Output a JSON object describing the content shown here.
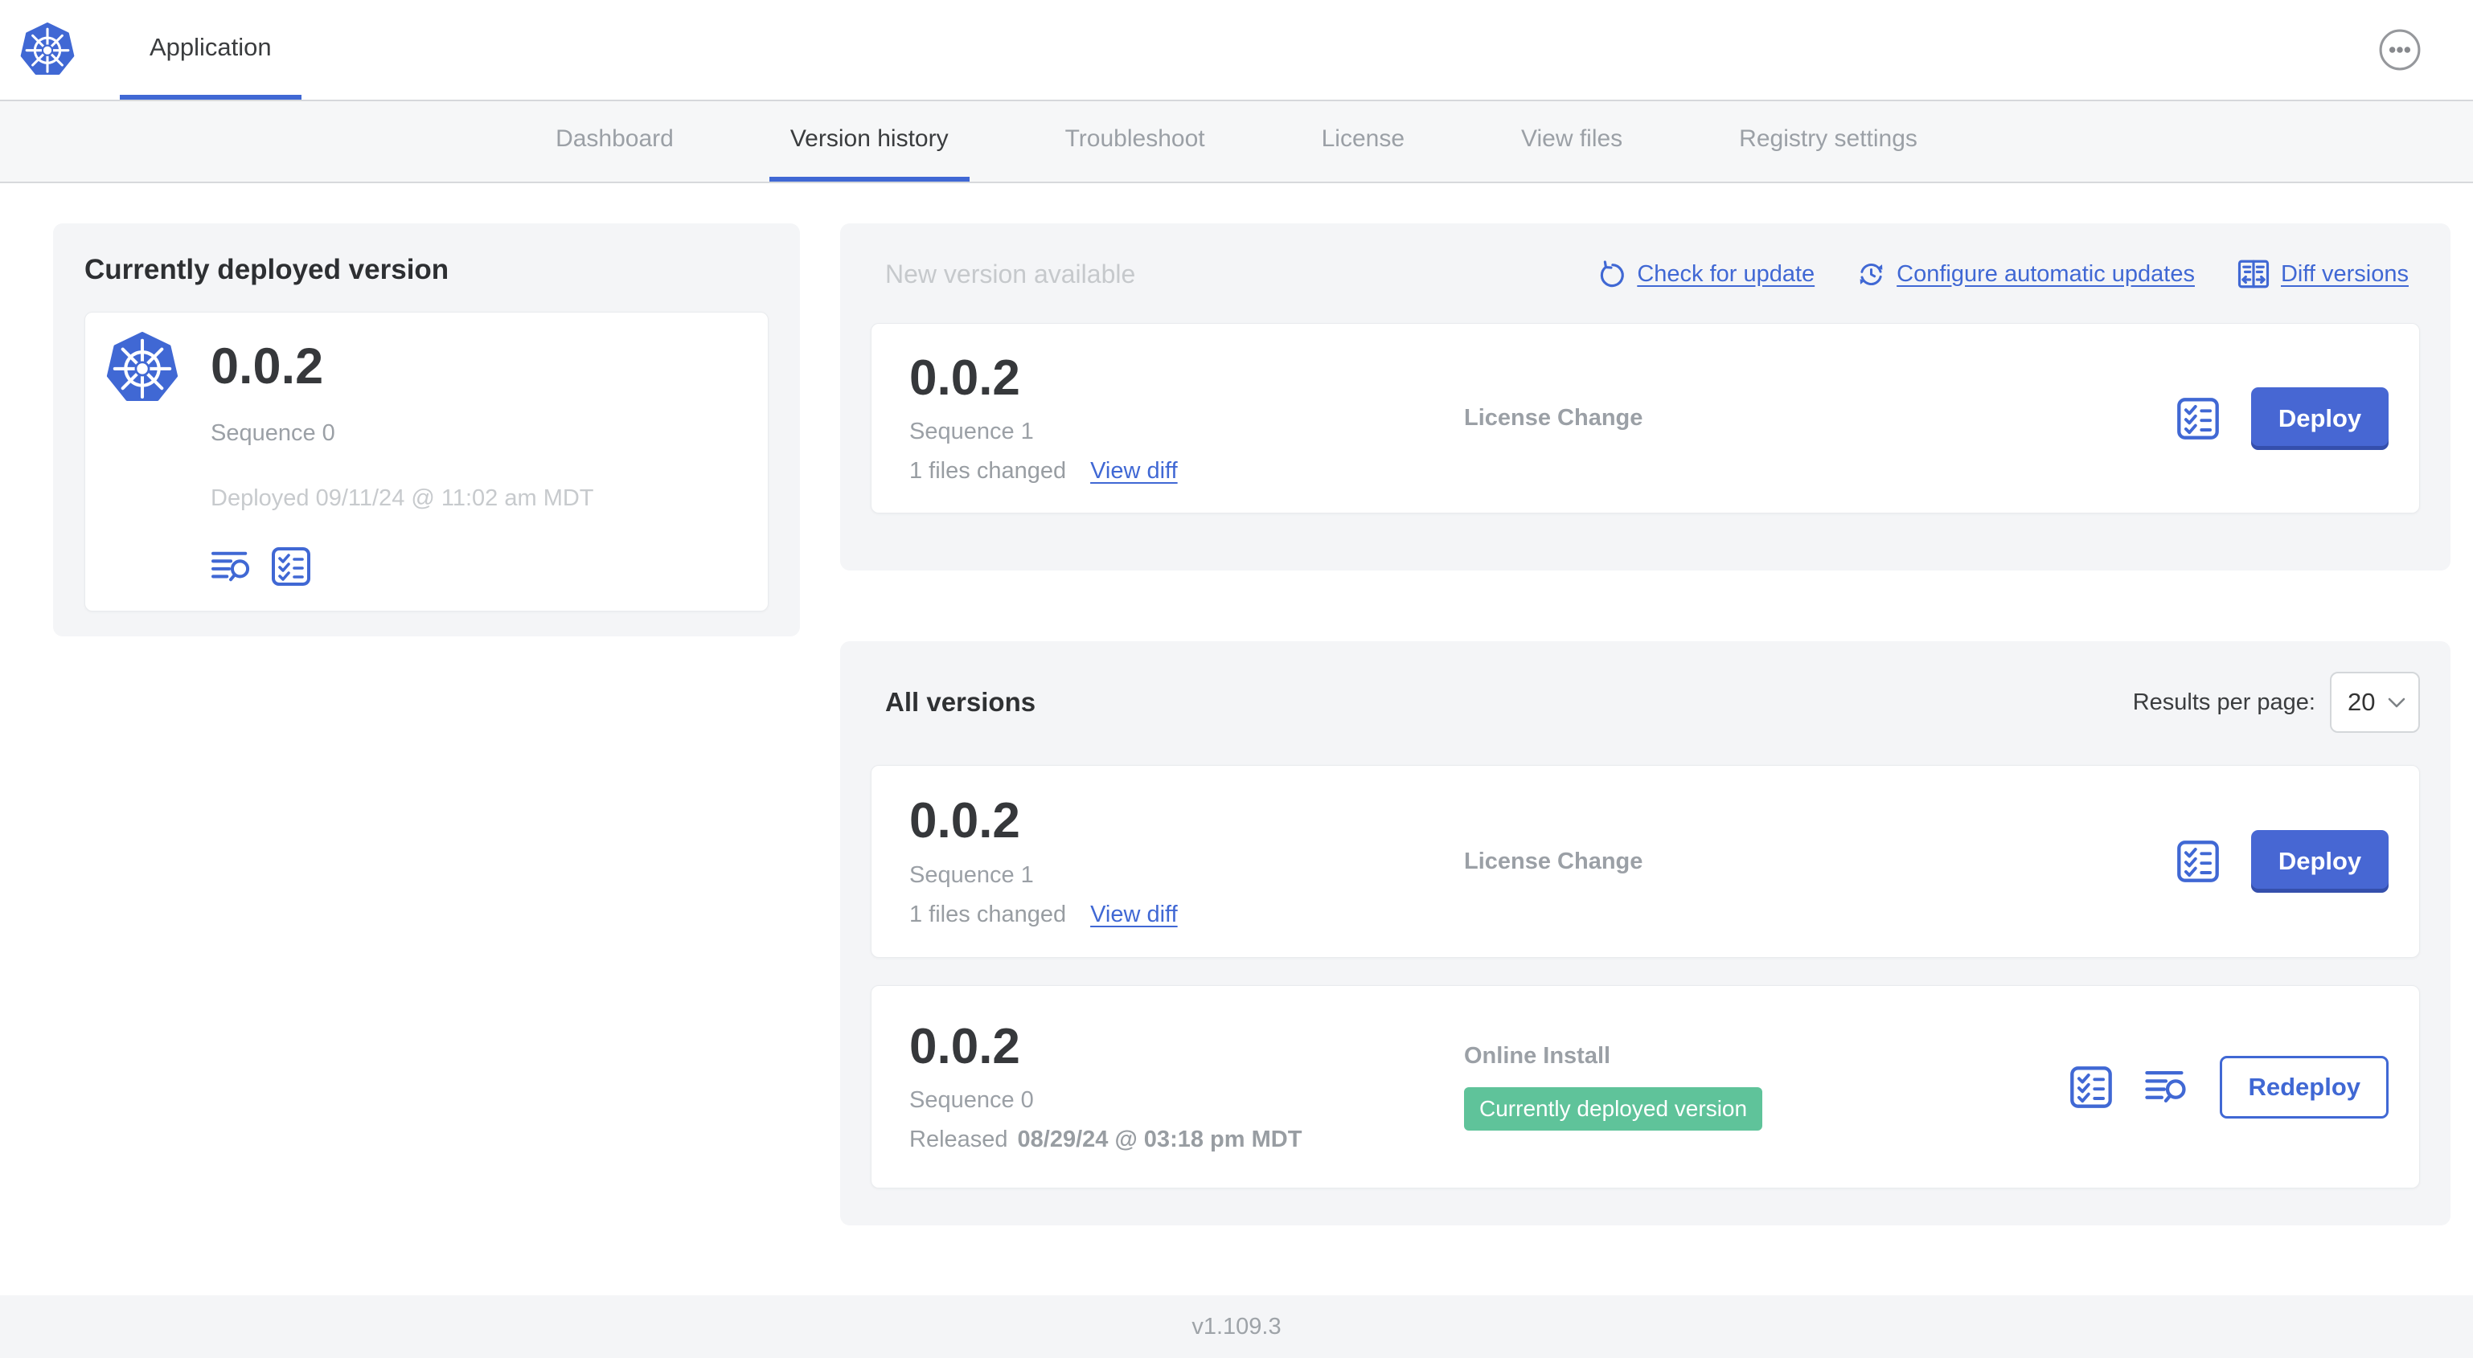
{
  "header": {
    "app_tab": "Application",
    "logo_icon": "kubernetes-logo",
    "overflow_icon": "ellipsis-icon"
  },
  "nav": {
    "active_tab": "Version history",
    "tabs": [
      {
        "label": "Dashboard"
      },
      {
        "label": "Version history"
      },
      {
        "label": "Troubleshoot"
      },
      {
        "label": "License"
      },
      {
        "label": "View files"
      },
      {
        "label": "Registry settings"
      }
    ]
  },
  "currently_deployed": {
    "title": "Currently deployed version",
    "version": "0.0.2",
    "sequence": "Sequence 0",
    "deployed": "Deployed 09/11/24 @ 11:02 am MDT",
    "icons": [
      "logs-icon",
      "checklist-icon"
    ]
  },
  "new_version": {
    "title": "New version available",
    "actions": [
      {
        "label": "Check for update",
        "icon": "refresh-icon"
      },
      {
        "label": "Configure automatic updates",
        "icon": "auto-update-clock-icon"
      },
      {
        "label": "Diff versions",
        "icon": "diff-icon"
      }
    ],
    "card": {
      "version": "0.0.2",
      "sequence": "Sequence 1",
      "files_changed": "1 files changed",
      "view_diff": "View diff",
      "source": "License Change",
      "deploy_label": "Deploy",
      "icons": [
        "checklist-icon"
      ]
    }
  },
  "all_versions": {
    "title": "All versions",
    "results_per_page_label": "Results per page:",
    "results_per_page_value": "20",
    "rows": [
      {
        "version": "0.0.2",
        "sequence": "Sequence 1",
        "files_changed": "1 files changed",
        "view_diff": "View diff",
        "source": "License Change",
        "button_label": "Deploy",
        "icons": [
          "checklist-icon"
        ]
      },
      {
        "version": "0.0.2",
        "sequence": "Sequence 0",
        "released_prefix": "Released",
        "released_date": "08/29/24 @ 03:18 pm MDT",
        "source": "Online Install",
        "badge": "Currently deployed version",
        "button_label": "Redeploy",
        "icons": [
          "checklist-icon",
          "logs-icon"
        ]
      }
    ]
  },
  "footer": {
    "version": "v1.109.3"
  },
  "colors": {
    "accent": "#4068d4",
    "button_blue": "#4767d3",
    "badge_green": "#5fc39a",
    "panel_bg": "#f4f5f7",
    "nav_inactive": "#9ba0a6",
    "muted": "#c6c9cc"
  }
}
